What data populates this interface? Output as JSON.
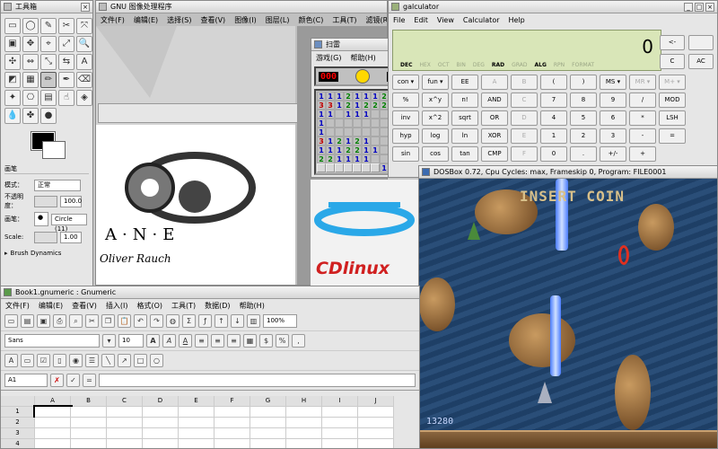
{
  "toolbox": {
    "title": "工具箱",
    "tools": [
      "▭",
      "◯",
      "✎",
      "✂",
      "⤧",
      "▣",
      "✥",
      "⌖",
      "⤢",
      "🔍",
      "✣",
      "⇔",
      "⤡",
      "⇆",
      "A",
      "◩",
      "▦",
      "✏",
      "✒",
      "⌫",
      "✦",
      "⎔",
      "▤",
      "☝",
      "◈",
      "💧",
      "✤",
      "●"
    ],
    "section": "画笔",
    "mode_label": "模式：",
    "mode_value": "正常",
    "opacity_label": "不透明度：",
    "opacity_value": "100.0",
    "brush_label": "画笔：",
    "brush_value": "Circle (11)",
    "scale_label": "Scale:",
    "scale_value": "1.00",
    "dynamics": "Brush Dynamics"
  },
  "gimp": {
    "title": "GNU 图像处理程序",
    "menu": [
      "文件(F)",
      "编辑(E)",
      "选择(S)",
      "查看(V)",
      "图像(I)",
      "图层(L)",
      "颜色(C)",
      "工具(T)",
      "滤镜(R)",
      "X"
    ],
    "art_word": "A·N·E",
    "art_sig": "Oliver Rauch"
  },
  "mines": {
    "title": "扫雷",
    "menu": [
      "游戏(G)",
      "帮助(H)"
    ],
    "count_left": "000",
    "count_right": "3",
    "rows": [
      [
        "1",
        "1",
        "1",
        "2",
        "1",
        "1",
        "1",
        "2",
        ""
      ],
      [
        "3",
        "3",
        "1",
        "2",
        "1",
        "2",
        "2",
        "2",
        ""
      ],
      [
        "1",
        "1",
        "",
        "1",
        "1",
        "1",
        "",
        "",
        ""
      ],
      [
        "1",
        "",
        "",
        "",
        "",
        "",
        "",
        "",
        ""
      ],
      [
        "1",
        "",
        "",
        "",
        "",
        "",
        "",
        "",
        ""
      ],
      [
        "3",
        "1",
        "2",
        "1",
        "2",
        "1",
        "",
        "",
        ""
      ],
      [
        "1",
        "1",
        "1",
        "2",
        "2",
        "1",
        "1",
        "",
        ""
      ],
      [
        "2",
        "2",
        "1",
        "1",
        "1",
        "1",
        "",
        "",
        ""
      ],
      [
        "",
        "",
        "",
        "",
        "",
        "",
        "",
        "1",
        "1"
      ]
    ]
  },
  "calc": {
    "title": "galculator",
    "menu": [
      "File",
      "Edit",
      "View",
      "Calculator",
      "Help"
    ],
    "display": "0",
    "modes": [
      {
        "t": "DEC",
        "on": true
      },
      {
        "t": "HEX",
        "on": false
      },
      {
        "t": "OCT",
        "on": false
      },
      {
        "t": "BIN",
        "on": false
      },
      {
        "t": "DEG",
        "on": false
      },
      {
        "t": "RAD",
        "on": true
      },
      {
        "t": "GRAD",
        "on": false
      },
      {
        "t": "ALG",
        "on": true
      },
      {
        "t": "RPN",
        "on": false
      },
      {
        "t": "FORMAT",
        "on": false
      }
    ],
    "side": [
      "<-",
      "",
      "C",
      "AC"
    ],
    "rows": [
      [
        "con ▾",
        "fun ▾",
        "EE",
        "A",
        "B",
        "(",
        ")",
        "MS ▾",
        "MR ▾",
        "M+ ▾"
      ],
      [
        "%",
        "x^y",
        "n!",
        "AND",
        "C",
        "7",
        "8",
        "9",
        "/",
        "MOD"
      ],
      [
        "inv",
        "x^2",
        "sqrt",
        "OR",
        "D",
        "4",
        "5",
        "6",
        "*",
        "LSH"
      ],
      [
        "hyp",
        "log",
        "ln",
        "XOR",
        "E",
        "1",
        "2",
        "3",
        "-",
        "="
      ],
      [
        "sin",
        "cos",
        "tan",
        "CMP",
        "F",
        "0",
        ".",
        "+/-",
        "+",
        ""
      ]
    ]
  },
  "dosbox": {
    "title": "DOSBox 0.72, Cpu Cycles:      max, Frameskip  0, Program: FILE0001",
    "insert": "INSERT COIN",
    "score": "13280"
  },
  "desktop": {
    "brand": "CDlinux"
  },
  "gnumeric": {
    "title": "Book1.gnumeric : Gnumeric",
    "menu": [
      "文件(F)",
      "编辑(E)",
      "查看(V)",
      "插入(I)",
      "格式(O)",
      "工具(T)",
      "数据(D)",
      "帮助(H)"
    ],
    "zoom": "100%",
    "font": "Sans",
    "size": "10",
    "cellref": "A1",
    "columns": [
      "",
      "A",
      "B",
      "C",
      "D",
      "E",
      "F",
      "G",
      "H",
      "I",
      "J"
    ],
    "rows": [
      "1",
      "2",
      "3",
      "4"
    ]
  }
}
